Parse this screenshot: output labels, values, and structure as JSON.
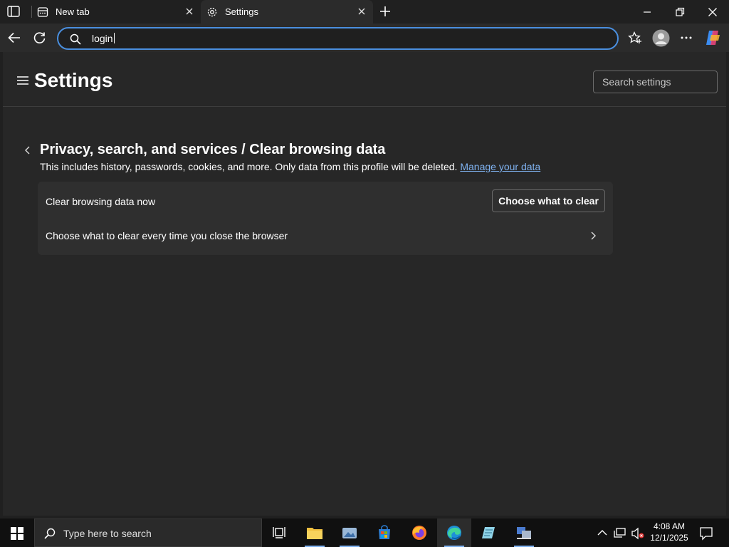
{
  "tabs": [
    {
      "label": "New tab"
    },
    {
      "label": "Settings"
    }
  ],
  "address_bar": {
    "value": "login"
  },
  "settings": {
    "title": "Settings",
    "search_placeholder": "Search settings",
    "breadcrumb": "Privacy, search, and services / Clear browsing data",
    "description": "This includes history, passwords, cookies, and more. Only data from this profile will be deleted.",
    "manage_link": "Manage your data",
    "row1_label": "Clear browsing data now",
    "choose_button": "Choose what to clear",
    "row2_label": "Choose what to clear every time you close the browser"
  },
  "taskbar": {
    "search_placeholder": "Type here to search",
    "time": "4:08 AM",
    "date": "12/1/2025"
  }
}
